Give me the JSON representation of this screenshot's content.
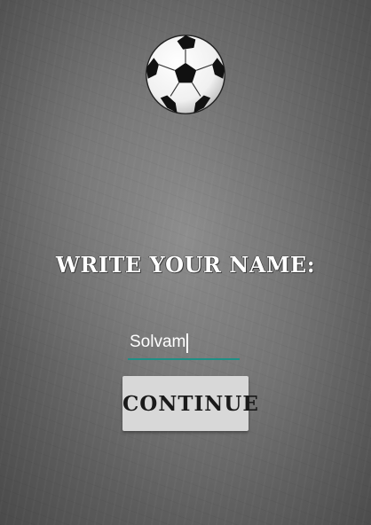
{
  "background": {
    "style": "chalkboard",
    "color": "#6e6e6e"
  },
  "header": {
    "logo_icon": "soccer-ball-icon"
  },
  "form": {
    "prompt": "WRITE YOUR NAME:",
    "name_value": "Solvam",
    "input_underline_color": "#1f8f86",
    "continue_label": "CONTINUE"
  }
}
